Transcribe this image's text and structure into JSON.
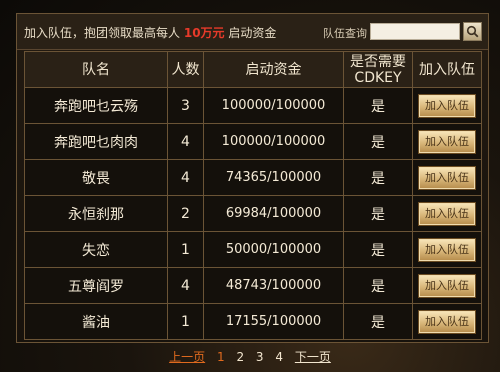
{
  "header": {
    "promo_text": "加入队伍，抱团领取最高每人",
    "promo_highlight": "10万元",
    "promo_suffix": "启动资金",
    "search_label": "队伍查询",
    "search_value": "",
    "search_icon": "search-icon"
  },
  "table": {
    "columns": [
      "队名",
      "人数",
      "启动资金",
      "是否需要CDKEY",
      "加入队伍"
    ],
    "rows": [
      {
        "name": "奔跑吧乜云殇",
        "members": "3",
        "funds": "100000/100000",
        "cdkey": "是",
        "action": "加入队伍"
      },
      {
        "name": "奔跑吧乜肉肉",
        "members": "4",
        "funds": "100000/100000",
        "cdkey": "是",
        "action": "加入队伍"
      },
      {
        "name": "敬畏",
        "members": "4",
        "funds": "74365/100000",
        "cdkey": "是",
        "action": "加入队伍"
      },
      {
        "name": "永恒刹那",
        "members": "2",
        "funds": "69984/100000",
        "cdkey": "是",
        "action": "加入队伍"
      },
      {
        "name": "失恋",
        "members": "1",
        "funds": "50000/100000",
        "cdkey": "是",
        "action": "加入队伍"
      },
      {
        "name": "五尊阎罗",
        "members": "4",
        "funds": "48743/100000",
        "cdkey": "是",
        "action": "加入队伍"
      },
      {
        "name": "酱油",
        "members": "1",
        "funds": "17155/100000",
        "cdkey": "是",
        "action": "加入队伍"
      }
    ]
  },
  "pager": {
    "prev": "上一页",
    "pages": [
      "1",
      "2",
      "3",
      "4"
    ],
    "current": "1",
    "next": "下一页"
  },
  "colors": {
    "highlight": "#e73a2a",
    "pager_active": "#e06a1e",
    "border": "#6b5436"
  }
}
